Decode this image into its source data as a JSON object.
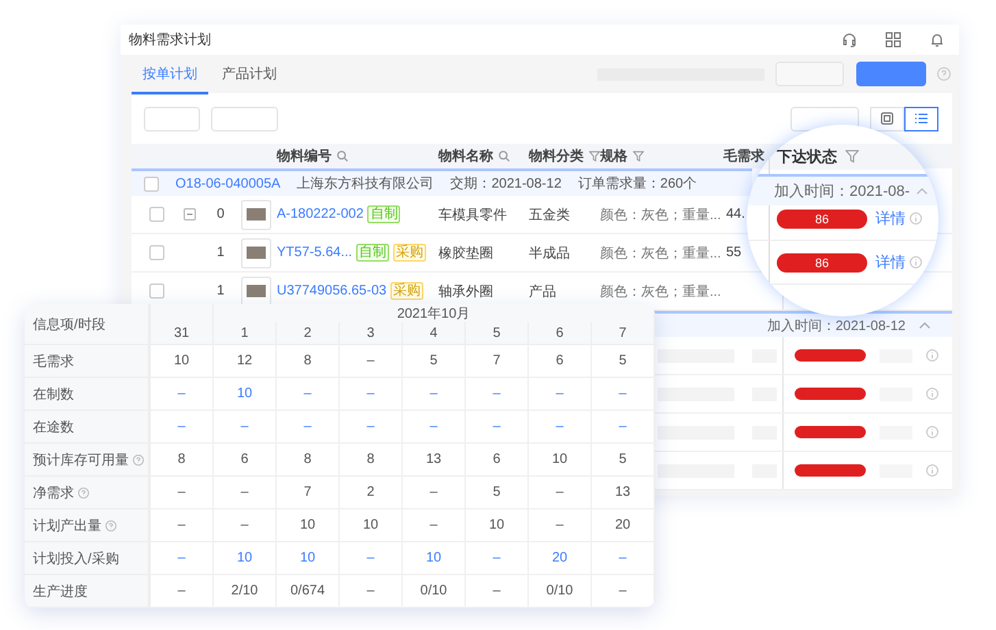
{
  "window": {
    "title": "物料需求计划"
  },
  "tabs": [
    {
      "label": "按单计划",
      "selected": true
    },
    {
      "label": "产品计划",
      "selected": false
    }
  ],
  "view_switch": [
    {
      "selected": false
    },
    {
      "selected": true
    }
  ],
  "table": {
    "columns": [
      {
        "label": "物料编号",
        "kind": "search"
      },
      {
        "label": "物料名称",
        "kind": "search"
      },
      {
        "label": "物料分类",
        "kind": "filter"
      },
      {
        "label": "规格",
        "kind": "filter"
      },
      {
        "label": "毛需求",
        "kind": "plain"
      }
    ],
    "group": {
      "checked": false,
      "order": "O18-06-040005A",
      "customer": "上海东方科技有限公司",
      "delivery": "交期：2021-08-12",
      "quantity": "订单需求量：260个"
    },
    "rows": [
      {
        "checked": false,
        "expandable": true,
        "level": "0",
        "code": "A-180222-002",
        "tags": [
          {
            "label": "自制",
            "kind": "make"
          }
        ],
        "name": "车模具零件",
        "category": "五金类",
        "spec": "颜色：灰色；重量...",
        "gross": "44."
      },
      {
        "checked": false,
        "expandable": false,
        "level": "1",
        "code": "YT57-5.64...",
        "tags": [
          {
            "label": "自制",
            "kind": "make"
          },
          {
            "label": "采购",
            "kind": "buy"
          }
        ],
        "name": "橡胶垫圈",
        "category": "半成品",
        "spec": "颜色：灰色；重量...",
        "gross": "55"
      },
      {
        "checked": false,
        "expandable": false,
        "level": "1",
        "code": "U37749056.65-03",
        "tags": [
          {
            "label": "采购",
            "kind": "buy"
          }
        ],
        "name": "轴承外圈",
        "category": "产品",
        "spec": "颜色：灰色；重量...",
        "gross": ""
      }
    ],
    "lower_group": {
      "label": "加入时间：2021-08-12"
    }
  },
  "magnifier": {
    "header": "下达状态",
    "group_label": "加入时间：2021-08-",
    "rows": [
      {
        "status": "86",
        "link": "详情"
      },
      {
        "status": "86",
        "link": "详情"
      }
    ]
  },
  "plan_grid": {
    "corner": "信息项/时段",
    "month": "2021年10月",
    "days": [
      "31",
      "1",
      "2",
      "3",
      "4",
      "5",
      "6",
      "7"
    ],
    "rows": [
      {
        "label": "毛需求",
        "info": false,
        "kind": "plain",
        "values": [
          "10",
          "12",
          "8",
          "–",
          "5",
          "7",
          "6",
          "5"
        ]
      },
      {
        "label": "在制数",
        "info": false,
        "kind": "link",
        "values": [
          "–",
          "10",
          "–",
          "–",
          "–",
          "–",
          "–",
          "–"
        ]
      },
      {
        "label": "在途数",
        "info": false,
        "kind": "link",
        "values": [
          "–",
          "–",
          "–",
          "–",
          "–",
          "–",
          "–",
          "–"
        ]
      },
      {
        "label": "预计库存可用量",
        "info": true,
        "kind": "plain",
        "values": [
          "8",
          "6",
          "8",
          "8",
          "13",
          "6",
          "10",
          "5"
        ]
      },
      {
        "label": "净需求",
        "info": true,
        "kind": "plain",
        "values": [
          "–",
          "–",
          "7",
          "2",
          "–",
          "5",
          "–",
          "13"
        ]
      },
      {
        "label": "计划产出量",
        "info": true,
        "kind": "plain",
        "values": [
          "–",
          "–",
          "10",
          "10",
          "–",
          "10",
          "–",
          "20"
        ]
      },
      {
        "label": "计划投入/采购",
        "info": false,
        "kind": "link",
        "values": [
          "–",
          "10",
          "10",
          "–",
          "10",
          "–",
          "20",
          "–"
        ]
      },
      {
        "label": "生产进度",
        "info": false,
        "kind": "plain",
        "values": [
          "–",
          "2/10",
          "0/674",
          "–",
          "0/10",
          "–",
          "0/10",
          "–"
        ]
      }
    ]
  }
}
